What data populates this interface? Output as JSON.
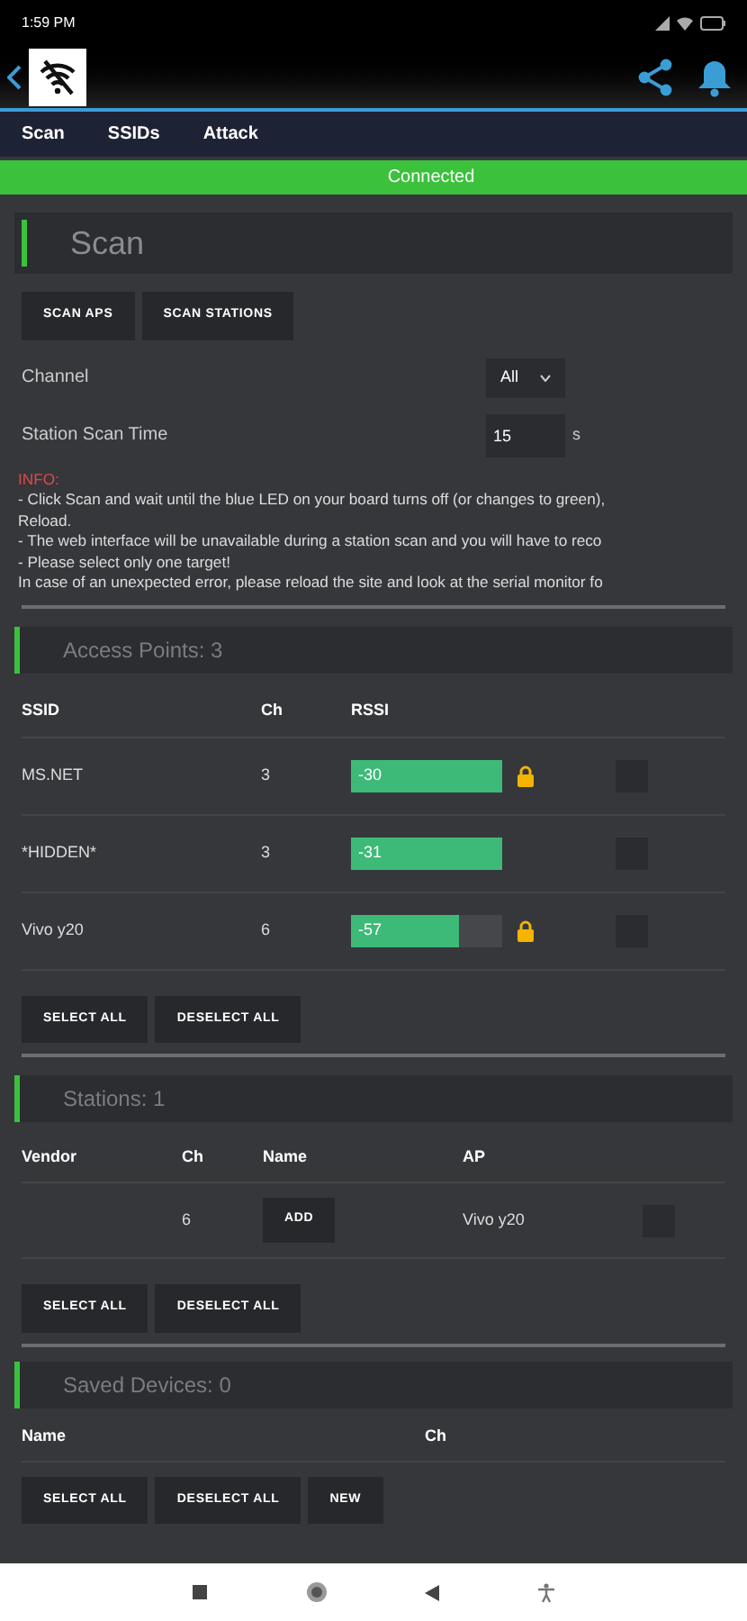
{
  "status_bar": {
    "time": "1:59 PM"
  },
  "nav": {
    "tabs": [
      {
        "label": "Scan",
        "selected": false
      },
      {
        "label": "SSIDs",
        "selected": false
      },
      {
        "label": "Attack",
        "selected": false
      }
    ]
  },
  "connection": {
    "label": "Connected",
    "connected": true
  },
  "scan": {
    "title": "Scan",
    "buttons": [
      "SCAN APS",
      "SCAN STATIONS"
    ],
    "channel": {
      "label": "Channel",
      "value": "All"
    },
    "scan_time": {
      "label": "Station Scan Time",
      "value": "15",
      "unit": "s"
    },
    "info": {
      "heading": "INFO:",
      "lines": [
        "- Click Scan and wait until the blue LED on your board turns off (or changes to green),",
        "Reload.",
        "- The web interface will be unavailable during a station scan and you will have to reco",
        "- Please select only one target!",
        "In case of an unexpected error, please reload the site and look at the serial monitor fo"
      ]
    }
  },
  "access_points": {
    "title": "Access Points: 3",
    "columns": [
      "SSID",
      "Ch",
      "RSSI"
    ],
    "rows": [
      {
        "ssid": "MS.NET",
        "ch": "3",
        "rssi": "-30",
        "level": 1,
        "locked": true,
        "checked": false
      },
      {
        "ssid": "*HIDDEN*",
        "ch": "3",
        "rssi": "-31",
        "level": 1,
        "locked": false,
        "checked": false
      },
      {
        "ssid": "Vivo y20",
        "ch": "6",
        "rssi": "-57",
        "level": 0.72,
        "locked": true,
        "checked": false
      }
    ],
    "buttons": [
      "SELECT ALL",
      "DESELECT ALL"
    ]
  },
  "stations": {
    "title": "Stations: 1",
    "columns": [
      "Vendor",
      "Ch",
      "Name",
      "AP"
    ],
    "rows": [
      {
        "ch": "6",
        "name_button": "ADD",
        "ap": "Vivo y20",
        "checked": false
      }
    ],
    "buttons": [
      "SELECT ALL",
      "DESELECT ALL"
    ]
  },
  "saved_devices": {
    "title": "Saved Devices: 0",
    "columns": [
      "Name",
      "Ch"
    ],
    "buttons": [
      "SELECT ALL",
      "DESELECT ALL",
      "NEW"
    ]
  }
}
